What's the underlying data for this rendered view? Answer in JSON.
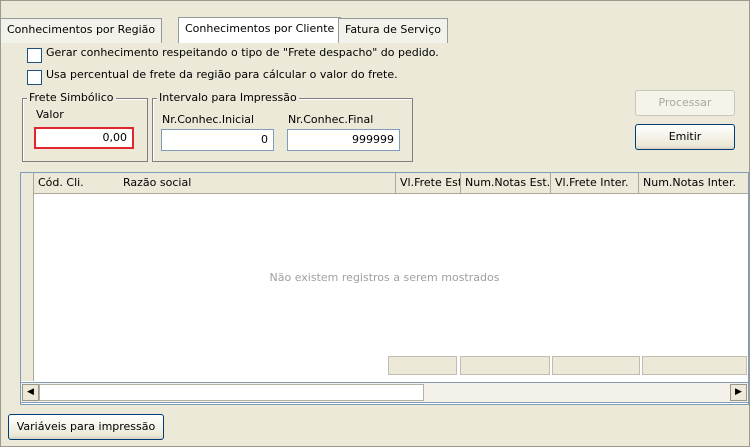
{
  "tabs": [
    {
      "label": "Conhecimentos por Região",
      "active": false
    },
    {
      "label": "Conhecimentos por Cliente",
      "active": true
    },
    {
      "label": "Fatura de Serviço",
      "active": false
    }
  ],
  "options": {
    "frete_despacho": "Gerar conhecimento respeitando o tipo de \"Frete despacho\" do pedido.",
    "percentual_regiao": "Usa percentual de frete da região para cálcular o valor do frete."
  },
  "frete_simbolico": {
    "title": "Frete Simbólico",
    "valor_label": "Valor",
    "valor": "0,00"
  },
  "intervalo": {
    "title": "Intervalo para Impressão",
    "inicial_label": "Nr.Conhec.Inicial",
    "inicial_value": "0",
    "final_label": "Nr.Conhec.Final",
    "final_value": "999999"
  },
  "buttons": {
    "processar": "Processar",
    "emitir": "Emitir",
    "variaveis": "Variáveis para impressão"
  },
  "grid": {
    "columns": [
      "Cód. Cli.",
      "Razão social",
      "Vl.Frete Est.",
      "Num.Notas Est.",
      "Vl.Frete Inter.",
      "Num.Notas Inter."
    ],
    "empty_message": "Não existem registros a serem mostrados"
  },
  "colors": {
    "highlight_border": "#e0262d",
    "window_bg": "#ece9d8"
  }
}
